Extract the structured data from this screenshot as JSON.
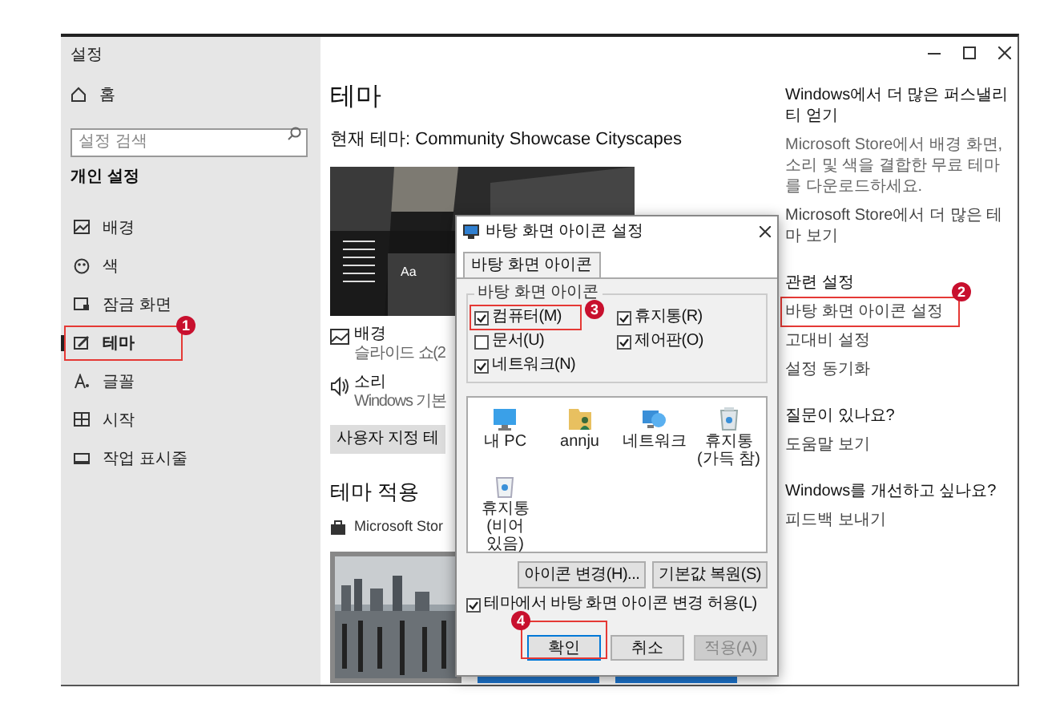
{
  "window": {
    "title": "설정"
  },
  "sidebar": {
    "home": "홈",
    "search": {
      "placeholder": "설정 검색"
    },
    "section": "개인 설정",
    "items": [
      {
        "label": "배경",
        "selected": false
      },
      {
        "label": "색",
        "selected": false
      },
      {
        "label": "잠금 화면",
        "selected": false
      },
      {
        "label": "테마",
        "selected": true,
        "badge": "1"
      },
      {
        "label": "글꼴",
        "selected": false
      },
      {
        "label": "시작",
        "selected": false
      },
      {
        "label": "작업 표시줄",
        "selected": false
      }
    ]
  },
  "main": {
    "title": "테마",
    "current_theme": "현재 테마: Community Showcase Cityscapes",
    "preview_tile_label": "Aa",
    "settings": [
      {
        "label": "배경",
        "value": "슬라이드 쇼(2"
      },
      {
        "label": "소리",
        "value": "Windows 기본"
      }
    ],
    "custom_button": "사용자 지정 테",
    "apply_heading": "테마 적용",
    "store_link": "Microsoft Stor"
  },
  "related": {
    "sections": [
      {
        "heading": "Windows에서 더 많은 퍼스낼리티 얻기",
        "lines": [
          {
            "kind": "text",
            "text": "Microsoft Store에서 배경 화면, 소리 및 색을 결합한 무료 테마를 다운로드하세요."
          },
          {
            "kind": "link",
            "text": "Microsoft Store에서 더 많은 테마 보기"
          }
        ]
      },
      {
        "heading": "관련 설정",
        "lines": [
          {
            "kind": "link",
            "text": "바탕 화면 아이콘 설정",
            "badge": "2"
          },
          {
            "kind": "link",
            "text": "고대비 설정"
          },
          {
            "kind": "link",
            "text": "설정 동기화"
          }
        ]
      },
      {
        "heading": "질문이 있나요?",
        "lines": [
          {
            "kind": "link",
            "text": "도움말 보기"
          }
        ]
      },
      {
        "heading": "Windows를 개선하고 싶나요?",
        "lines": [
          {
            "kind": "link",
            "text": "피드백 보내기"
          }
        ]
      }
    ]
  },
  "dialog": {
    "title": "바탕 화면 아이콘 설정",
    "tabs": [
      {
        "label": "바탕 화면 아이콘",
        "selected": true
      }
    ],
    "group": "바탕 화면 아이콘",
    "checkboxes": [
      {
        "label": "컴퓨터(M)",
        "checked": true,
        "badge": "3"
      },
      {
        "label": "휴지통(R)",
        "checked": true
      },
      {
        "label": "문서(U)",
        "checked": false
      },
      {
        "label": "제어판(O)",
        "checked": true
      },
      {
        "label": "네트워크(N)",
        "checked": true
      }
    ],
    "icons": [
      {
        "label": "내 PC"
      },
      {
        "label": "annju"
      },
      {
        "label": "네트워크"
      },
      {
        "label": "휴지통 (가득 참)"
      },
      {
        "label": "휴지통 (비어 있음)"
      }
    ],
    "icon_buttons": [
      "아이콘 변경(H)...",
      "기본값 복원(S)"
    ],
    "allow_themes": {
      "label": "테마에서 바탕 화면 아이콘 변경 허용(L)",
      "checked": true
    },
    "buttons": [
      {
        "label": "확인",
        "default": true,
        "disabled": false,
        "badge": "4"
      },
      {
        "label": "취소",
        "default": false,
        "disabled": false
      },
      {
        "label": "적용(A)",
        "default": false,
        "disabled": true
      }
    ]
  }
}
